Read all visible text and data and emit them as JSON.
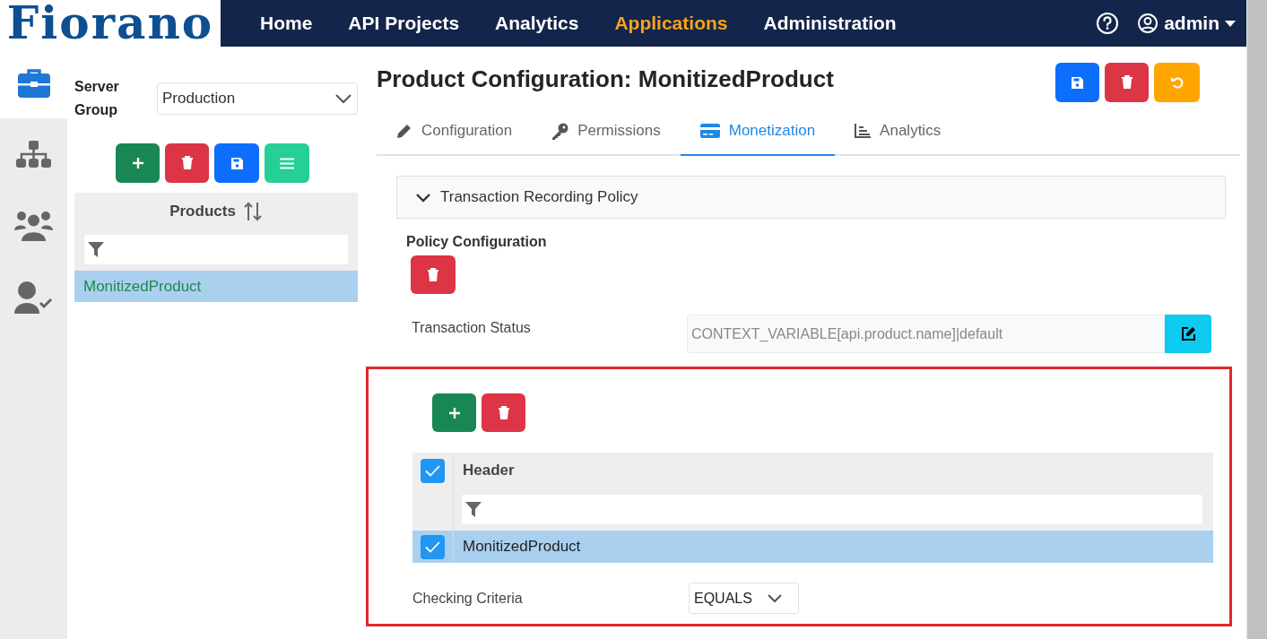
{
  "logo": {
    "text": "Fiorano"
  },
  "nav": {
    "items": [
      {
        "label": "Home",
        "selected": false
      },
      {
        "label": "API Projects",
        "selected": false
      },
      {
        "label": "Analytics",
        "selected": false
      },
      {
        "label": "Applications",
        "selected": true
      },
      {
        "label": "Administration",
        "selected": false
      }
    ],
    "user": "admin"
  },
  "rail": [
    {
      "kind": "briefcase",
      "selected": true
    },
    {
      "kind": "sitemap",
      "selected": false
    },
    {
      "kind": "users",
      "selected": false
    },
    {
      "kind": "user-check",
      "selected": false
    }
  ],
  "server_group": {
    "label": "Server Group",
    "value": "Production"
  },
  "products": {
    "title": "Products",
    "rows": [
      {
        "label": "MonitizedProduct",
        "selected": true
      }
    ]
  },
  "page_title": "Product Configuration: MonitizedProduct",
  "tabs": [
    {
      "label": "Configuration",
      "selected": false
    },
    {
      "label": "Permissions",
      "selected": false
    },
    {
      "label": "Monetization",
      "selected": true
    },
    {
      "label": "Analytics",
      "selected": false
    }
  ],
  "accordion": {
    "title": "Transaction Recording Policy",
    "expanded": true
  },
  "policy": {
    "title": "Policy Configuration",
    "status_label": "Transaction Status",
    "status_value": "CONTEXT_VARIABLE[api.product.name]|default"
  },
  "header_table": {
    "column": "Header",
    "all_checked": true,
    "rows": [
      {
        "label": "MonitizedProduct",
        "checked": true,
        "selected": true
      }
    ]
  },
  "checking_criteria": {
    "label": "Checking Criteria",
    "value": "EQUALS"
  }
}
